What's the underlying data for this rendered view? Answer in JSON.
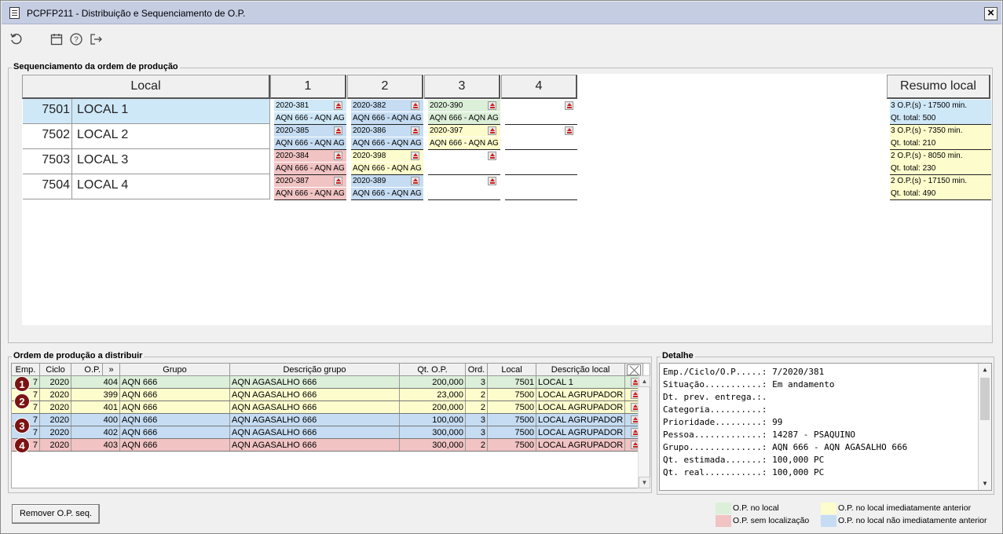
{
  "window": {
    "title": "PCPFP211 - Distribuição e Sequenciamento de O.P."
  },
  "toolbar": {
    "icons": [
      "refresh-icon",
      "calendar-icon",
      "help-icon",
      "exit-icon"
    ]
  },
  "sequencing": {
    "legend": "Sequenciamento da ordem de produção",
    "local_header": "Local",
    "columns": [
      "1",
      "2",
      "3",
      "4"
    ],
    "summary_header": "Resumo local",
    "rows": [
      {
        "num": "7501",
        "name": "LOCAL 1",
        "cells": [
          {
            "op": "2020-381",
            "group": "AQN 666 - AQN AG",
            "color": "sel"
          },
          {
            "op": "2020-382",
            "group": "AQN 666 - AQN AG",
            "color": "blue"
          },
          {
            "op": "2020-390",
            "group": "AQN 666 - AQN AG",
            "color": "green"
          },
          {
            "op": "",
            "group": "",
            "color": "empty-eject"
          }
        ],
        "summary": {
          "line1": "3 O.P.(s) - 17500 min.",
          "line2": "Qt. total: 500"
        }
      },
      {
        "num": "7502",
        "name": "LOCAL 2",
        "cells": [
          {
            "op": "2020-385",
            "group": "AQN 666 - AQN AG",
            "color": "blue"
          },
          {
            "op": "2020-386",
            "group": "AQN 666 - AQN AG",
            "color": "blue"
          },
          {
            "op": "2020-397",
            "group": "AQN 666 - AQN AG",
            "color": "yellow"
          },
          {
            "op": "",
            "group": "",
            "color": "empty-eject"
          }
        ],
        "summary": {
          "line1": "3 O.P.(s) - 7350 min.",
          "line2": "Qt. total: 210"
        }
      },
      {
        "num": "7503",
        "name": "LOCAL 3",
        "cells": [
          {
            "op": "2020-384",
            "group": "AQN 666 - AQN AG",
            "color": "red"
          },
          {
            "op": "2020-398",
            "group": "AQN 666 - AQN AG",
            "color": "yellow"
          },
          {
            "op": "",
            "group": "",
            "color": "empty-eject"
          },
          {
            "op": "",
            "group": "",
            "color": "empty"
          }
        ],
        "summary": {
          "line1": "2 O.P.(s) - 8050 min.",
          "line2": "Qt. total: 230"
        }
      },
      {
        "num": "7504",
        "name": "LOCAL 4",
        "cells": [
          {
            "op": "2020-387",
            "group": "AQN 666 - AQN AG",
            "color": "red"
          },
          {
            "op": "2020-389",
            "group": "AQN 666 - AQN AG",
            "color": "blue"
          },
          {
            "op": "",
            "group": "",
            "color": "empty-eject"
          },
          {
            "op": "",
            "group": "",
            "color": "empty"
          }
        ],
        "summary": {
          "line1": "2 O.P.(s) - 17150 min.",
          "line2": "Qt. total: 490"
        }
      }
    ]
  },
  "distribute": {
    "legend": "Ordem de produção a distribuir",
    "headers": [
      "Emp.",
      "Ciclo",
      "O.P.",
      "»",
      "Grupo",
      "Descrição grupo",
      "Qt. O.P.",
      "Ord.",
      "Local",
      "Descrição local"
    ],
    "rows": [
      {
        "badge": "1",
        "emp": "7",
        "ciclo": "2020",
        "op": "404",
        "grupo": "AQN 666",
        "desc": "AQN AGASALHO 666",
        "qt": "200,000",
        "ord": "3",
        "local": "7501",
        "desc_local": "LOCAL 1",
        "color": "green"
      },
      {
        "badge": "2",
        "emp": "7",
        "ciclo": "2020",
        "op": "399",
        "grupo": "AQN 666",
        "desc": "AQN AGASALHO 666",
        "qt": "23,000",
        "ord": "2",
        "local": "7500",
        "desc_local": "LOCAL AGRUPADOR",
        "color": "yellow"
      },
      {
        "badge": "",
        "emp": "7",
        "ciclo": "2020",
        "op": "401",
        "grupo": "AQN 666",
        "desc": "AQN AGASALHO 666",
        "qt": "200,000",
        "ord": "2",
        "local": "7500",
        "desc_local": "LOCAL AGRUPADOR",
        "color": "yellow"
      },
      {
        "badge": "3",
        "emp": "7",
        "ciclo": "2020",
        "op": "400",
        "grupo": "AQN 666",
        "desc": "AQN AGASALHO 666",
        "qt": "100,000",
        "ord": "3",
        "local": "7500",
        "desc_local": "LOCAL AGRUPADOR",
        "color": "blue"
      },
      {
        "badge": "",
        "emp": "7",
        "ciclo": "2020",
        "op": "402",
        "grupo": "AQN 666",
        "desc": "AQN AGASALHO 666",
        "qt": "300,000",
        "ord": "3",
        "local": "7500",
        "desc_local": "LOCAL AGRUPADOR",
        "color": "blue"
      },
      {
        "badge": "4",
        "emp": "7",
        "ciclo": "2020",
        "op": "403",
        "grupo": "AQN 666",
        "desc": "AQN AGASALHO 666",
        "qt": "300,000",
        "ord": "2",
        "local": "7500",
        "desc_local": "LOCAL AGRUPADOR",
        "color": "red"
      }
    ]
  },
  "detail": {
    "legend": "Detalhe",
    "lines": [
      "Emp./Ciclo/O.P.....: 7/2020/381",
      "Situação...........: Em andamento",
      "Dt. prev. entrega.:.",
      "Categoria..........:",
      "Prioridade.........: 99",
      "Pessoa.............: 14287 - PSAQUINO",
      "Grupo..............: AQN 666 - AQN AGASALHO 666",
      "Qt. estimada.......: 100,000 PC",
      "Qt. real...........: 100,000 PC"
    ]
  },
  "buttons": {
    "remove": "Remover O.P. seq."
  },
  "legend_colors": [
    {
      "label": "O.P. no local",
      "color": "#dcefd9"
    },
    {
      "label": "O.P. no local imediatamente anterior",
      "color": "#fdfccc"
    },
    {
      "label": "O.P. sem localização",
      "color": "#f1c3c3"
    },
    {
      "label": "O.P. no local não imediatamente anterior",
      "color": "#c5dcf3"
    }
  ]
}
